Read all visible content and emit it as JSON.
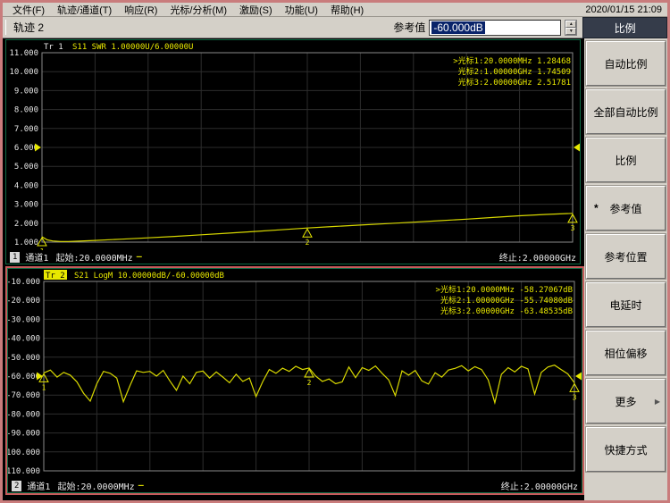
{
  "menu": {
    "items": [
      "文件(F)",
      "轨迹/通道(T)",
      "响应(R)",
      "光标/分析(M)",
      "激励(S)",
      "功能(U)",
      "帮助(H)"
    ],
    "clock": "2020/01/15 21:09"
  },
  "toolbar": {
    "trace_label": "轨迹 2",
    "ref_label": "参考值",
    "ref_value": "-60.000dB",
    "spinner_up": "▲",
    "spinner_down": "▼"
  },
  "sidebar": {
    "header": "比例",
    "buttons": [
      {
        "label": "自动比例"
      },
      {
        "label": "全部自动比例"
      },
      {
        "label": "比例"
      },
      {
        "label": "参考值",
        "marker": "*"
      },
      {
        "label": "参考位置"
      },
      {
        "label": "电延时"
      },
      {
        "label": "相位偏移"
      },
      {
        "label": "更多",
        "arrow": "▶"
      },
      {
        "label": "快捷方式"
      }
    ]
  },
  "colors": {
    "trace": "#d8d800",
    "marker_text": "#e8e800",
    "grid": "#2d2d2d",
    "frame": "#8a8a8a",
    "window_border": "#c97c7c",
    "active_panel_border": "#c75b5b",
    "panel_border_green": "#0f6b45",
    "selection": "#0a246a"
  },
  "chart_data": [
    {
      "type": "line",
      "name": "s11-swr",
      "trace": "Tr 1",
      "title": "S11 SWR 1.00000U/6.00000U",
      "active": false,
      "ylim": [
        1,
        11
      ],
      "yticks": [
        "11.000",
        "10.000",
        "9.000",
        "8.000",
        "7.000",
        "6.000",
        "5.000",
        "4.000",
        "3.000",
        "2.000",
        "1.000"
      ],
      "ref": 6.0,
      "x_range": [
        "20.0000MHz",
        "2.00000GHz"
      ],
      "grid": true,
      "points": [
        [
          0,
          1.285
        ],
        [
          0.01,
          1.12
        ],
        [
          0.02,
          1.06
        ],
        [
          0.035,
          1.035
        ],
        [
          0.05,
          1.035
        ],
        [
          0.07,
          1.05
        ],
        [
          0.1,
          1.09
        ],
        [
          0.15,
          1.155
        ],
        [
          0.2,
          1.225
        ],
        [
          0.25,
          1.3
        ],
        [
          0.3,
          1.385
        ],
        [
          0.35,
          1.47
        ],
        [
          0.4,
          1.56
        ],
        [
          0.45,
          1.65
        ],
        [
          0.5,
          1.745
        ],
        [
          0.55,
          1.825
        ],
        [
          0.6,
          1.9
        ],
        [
          0.65,
          1.975
        ],
        [
          0.7,
          2.05
        ],
        [
          0.75,
          2.13
        ],
        [
          0.8,
          2.21
        ],
        [
          0.85,
          2.3
        ],
        [
          0.9,
          2.39
        ],
        [
          0.95,
          2.46
        ],
        [
          1,
          2.518
        ]
      ],
      "markers": [
        {
          "n": "1",
          "x": 0.0,
          "y": 1.28468
        },
        {
          "n": "2",
          "x": 0.5,
          "y": 1.74509
        },
        {
          "n": "3",
          "x": 1.0,
          "y": 2.51781
        }
      ],
      "readouts": [
        "光标1:20.0000MHz  1.28468",
        "光标2:1.00000GHz  1.74509",
        "光标3:2.00000GHz  2.51781"
      ],
      "selected_readout": 0,
      "status": {
        "badge": "1",
        "channel": "通道1",
        "start": "起始:20.0000MHz",
        "dash": "—",
        "stop": "终止:2.00000GHz"
      }
    },
    {
      "type": "line",
      "name": "s21-logm",
      "trace": "Tr 2",
      "title": "S21 LogM 10.00000dB/-60.00000dB",
      "active": true,
      "ylim": [
        -110,
        -10
      ],
      "yticks": [
        "-10.000",
        "-20.000",
        "-30.000",
        "-40.000",
        "-50.000",
        "-60.000",
        "-70.000",
        "-80.000",
        "-90.000",
        "-100.000",
        "-110.000"
      ],
      "ref": -60.0,
      "x_range": [
        "20.0000MHz",
        "2.00000GHz"
      ],
      "grid": true,
      "y": [
        -58.3,
        -56.8,
        -60.5,
        -58.0,
        -59.5,
        -63.0,
        -69.0,
        -73.2,
        -64.0,
        -57.5,
        -58.5,
        -61.0,
        -73.5,
        -65.0,
        -57.2,
        -58.0,
        -57.5,
        -60.0,
        -57.0,
        -62.5,
        -67.5,
        -60.0,
        -64.0,
        -58.0,
        -57.3,
        -61.0,
        -57.8,
        -60.5,
        -63.5,
        -59.0,
        -62.8,
        -61.0,
        -70.8,
        -63.0,
        -56.5,
        -58.5,
        -55.8,
        -57.5,
        -54.8,
        -56.5,
        -55.7,
        -60.0,
        -62.8,
        -61.5,
        -64.0,
        -63.0,
        -55.2,
        -60.8,
        -55.5,
        -57.0,
        -54.6,
        -58.5,
        -62.0,
        -70.3,
        -57.2,
        -59.5,
        -57.0,
        -62.5,
        -64.2,
        -58.2,
        -60.5,
        -56.8,
        -55.9,
        -54.5,
        -57.2,
        -55.0,
        -56.5,
        -62.0,
        -74.0,
        -59.0,
        -55.5,
        -57.8,
        -54.8,
        -56.2,
        -69.5,
        -58.0,
        -55.2,
        -54.2,
        -56.5,
        -58.8,
        -63.5
      ],
      "markers": [
        {
          "n": "1",
          "x": 0.0,
          "y": -58.27067
        },
        {
          "n": "2",
          "x": 0.5,
          "y": -55.7408
        },
        {
          "n": "3",
          "x": 1.0,
          "y": -63.48535
        }
      ],
      "readouts": [
        "光标1:20.0000MHz  -58.27067dB",
        "光标2:1.00000GHz  -55.74080dB",
        "光标3:2.00000GHz  -63.48535dB"
      ],
      "selected_readout": 0,
      "status": {
        "badge": "2",
        "channel": "通道1",
        "start": "起始:20.0000MHz",
        "dash": "—",
        "stop": "终止:2.00000GHz"
      }
    }
  ]
}
